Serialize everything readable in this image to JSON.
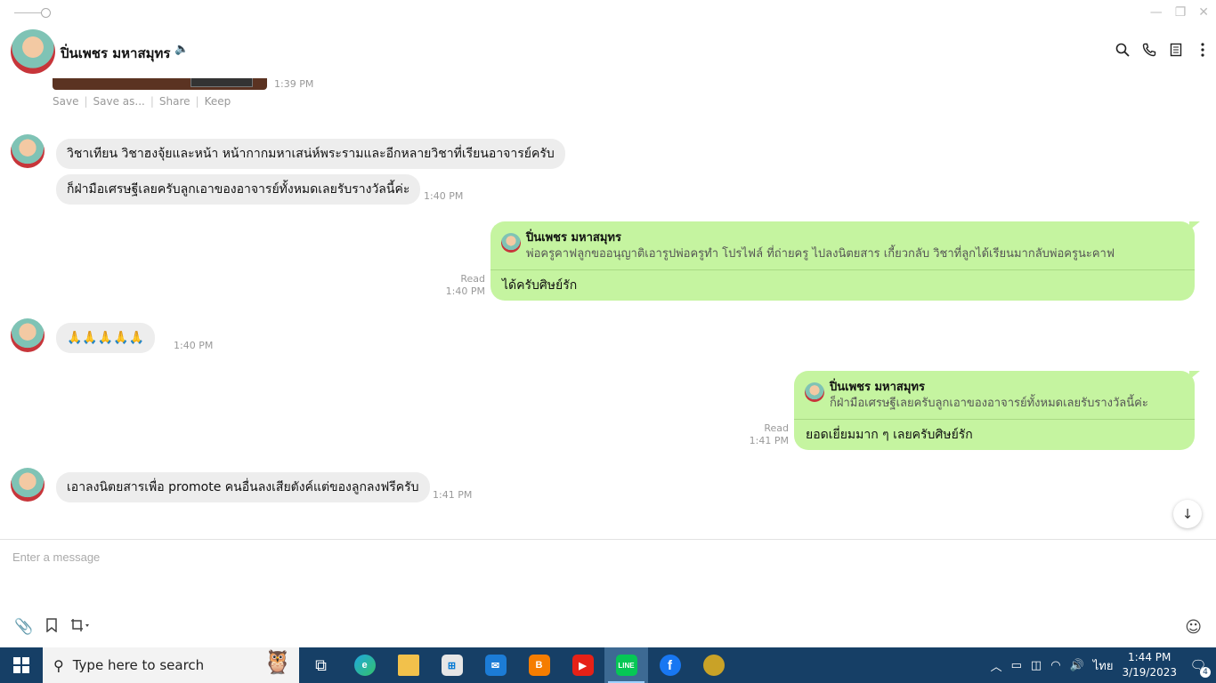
{
  "header": {
    "contact_name": "ปิ่นเพชร มหาสมุทร",
    "icons": [
      "search-icon",
      "phone-icon",
      "notes-icon",
      "more-icon"
    ]
  },
  "image_message": {
    "time": "1:39 PM",
    "actions": [
      "Save",
      "Save as...",
      "Share",
      "Keep"
    ]
  },
  "messages": [
    {
      "id": "m1",
      "text": "วิชาเทียน  วิชาฮงจุ้ยและหน้า หน้ากากมหาเสน่ห์พระรามและอีกหลายวิชาที่เรียนอาจารย์ครับ"
    },
    {
      "id": "m2",
      "text": "ก็ฝ่ามือเศรษฐีเลยครับลูกเอาของอาจารย์ทั้งหมดเลยรับรางวัลนี้ค่ะ",
      "time": "1:40 PM"
    },
    {
      "id": "m3",
      "outgoing": true,
      "status": "Read",
      "time": "1:40 PM",
      "quote_name": "ปิ่นเพชร มหาสมุทร",
      "quote_text": "พ่อครูคาฟลูกขออนุญาติเอารูปพ่อครูทำ โปรไฟล์  ที่ถ่ายครู   ไปลงนิตยสาร  เกี้ยวกลับ วิชาที่ลูกได้เรียนมากลับพ่อครูนะคาฟ",
      "text": "ได้ครับศิษย์รัก"
    },
    {
      "id": "m4",
      "text": "🙏🙏🙏🙏🙏",
      "time": "1:40 PM"
    },
    {
      "id": "m5",
      "outgoing": true,
      "status": "Read",
      "time": "1:41 PM",
      "quote_name": "ปิ่นเพชร มหาสมุทร",
      "quote_text": "ก็ฝ่ามือเศรษฐีเลยครับลูกเอาของอาจารย์ทั้งหมดเลยรับรางวัลนี้ค่ะ",
      "text": "ยอดเยี่ยมมาก ๆ เลยครับศิษย์รัก"
    },
    {
      "id": "m6",
      "text": "เอาลงนิตยสารเพื่อ promote คนอื่นลงเสียตังค์แต่ของลูกลงฟรีครับ",
      "time": "1:41 PM"
    }
  ],
  "composer": {
    "placeholder": "Enter a message",
    "tools": [
      "attach-icon",
      "bookmark-icon",
      "crop-icon",
      "emoji-icon"
    ]
  },
  "taskbar": {
    "search_placeholder": "Type here to search",
    "apps": [
      "task-view",
      "edge",
      "file-explorer",
      "store",
      "mail",
      "blogger",
      "youtube",
      "line",
      "facebook",
      "custom-app"
    ],
    "active_app": "line",
    "language": "ไทย",
    "time": "1:44 PM",
    "date": "3/19/2023",
    "notification_count": "4"
  }
}
